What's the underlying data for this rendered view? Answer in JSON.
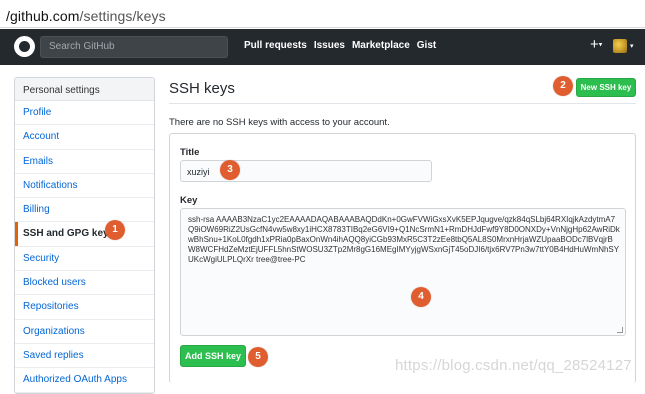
{
  "browser": {
    "url_host": "/github.com",
    "url_path": "/settings/keys"
  },
  "topnav": {
    "search_placeholder": "Search GitHub",
    "links": [
      "Pull requests",
      "Issues",
      "Marketplace",
      "Gist"
    ],
    "plus_label": "+",
    "caret": "▾"
  },
  "sidebar": {
    "header": "Personal settings",
    "items": [
      {
        "label": "Profile"
      },
      {
        "label": "Account"
      },
      {
        "label": "Emails"
      },
      {
        "label": "Notifications"
      },
      {
        "label": "Billing"
      },
      {
        "label": "SSH and GPG keys",
        "selected": true
      },
      {
        "label": "Security"
      },
      {
        "label": "Blocked users"
      },
      {
        "label": "Repositories"
      },
      {
        "label": "Organizations"
      },
      {
        "label": "Saved replies"
      },
      {
        "label": "Authorized OAuth Apps"
      }
    ]
  },
  "main": {
    "title": "SSH keys",
    "new_key_button": "New SSH key",
    "info_text": "There are no SSH keys with access to your account.",
    "title_label": "Title",
    "title_value": "xuziyi",
    "key_label": "Key",
    "key_value": "ssh-rsa AAAAB3NzaC1yc2EAAAADAQABAAABAQDdKn+0GwFVWiGxsXvK5EPJqugve/qzk84qSLbj64RXIqjkAzdytmA7Q9iOW69RiZ2UsGcfN4vw5w8xy1iHCX8783TIBq2eG6VI9+Q1NcSrmN1+RmDHJdFwf9Y8D0ONXDy+VnNjgHp62AwRiDkwBhSnu+1KoL0fgdh1xPRia0pBaxOnWn4ihAQQ8yiCGb93MxR5C3T2zEe8tbQ5AL8S0MrxnHrjaWZUpaaBODc7lBVqjrBW8WCFHdZeMztEjUFFL5hnStWOSU3ZTp2Mr8gG16MEgIMYyjgWSxnGjT45oDJI6/tjx6RV7Pn3w7ttY0B4HdHuWmNhSYUKcWgiULPLQrXr tree@tree-PC",
    "add_button": "Add SSH key"
  },
  "annotations": [
    "1",
    "2",
    "3",
    "4",
    "5"
  ],
  "watermark": "https://blog.csdn.net/qq_28524127",
  "colors": {
    "nav_bg": "#24292e",
    "primary_green": "#2cbe4e",
    "badge": "#e05d2f",
    "selected_indicator": "#e36209",
    "link": "#0366d6"
  }
}
